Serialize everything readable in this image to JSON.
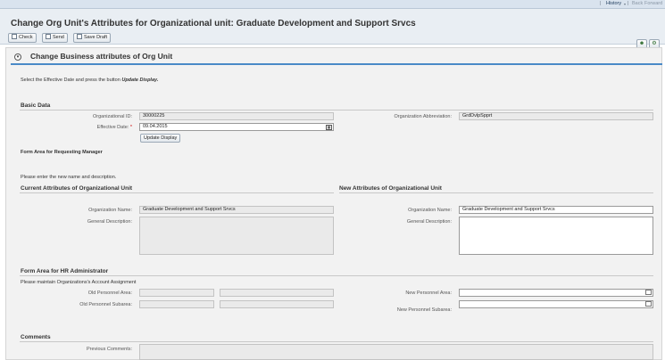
{
  "topnav": {
    "history": "History",
    "back": "Back",
    "forward": "Forward"
  },
  "header": {
    "title": "Change Org Unit's Attributes for Organizational unit: Graduate Development and Support Srvcs"
  },
  "toolbar": {
    "check": "Check",
    "send": "Send",
    "save_draft": "Save Draft"
  },
  "section": {
    "title": "Change Business attributes of Org Unit",
    "instruction_prefix": "Select the Effective Date and press the button ",
    "instruction_button": "Update Display."
  },
  "basic_data": {
    "heading": "Basic Data",
    "org_id_label": "Organizational ID:",
    "org_id_value": "30000225",
    "org_abbr_label": "Organization Abbreviation:",
    "org_abbr_value": "GrdDvlpSpprt",
    "effective_date_label": "Effective Date:",
    "required_mark": "*",
    "effective_date_value": "09.04.2015",
    "update_button": "Update Display"
  },
  "requesting_manager": {
    "heading": "Form Area for Requesting Manager",
    "instruction": "Please enter the new name and description."
  },
  "current": {
    "heading": "Current Attributes of Organizational Unit",
    "name_label": "Organization Name:",
    "name_value": "Graduate Development and Support Srvcs",
    "desc_label": "General Description:"
  },
  "new": {
    "heading": "New Attributes of Organizational Unit",
    "name_label": "Organization Name:",
    "name_value": "Graduate Development and Support Srvcs",
    "desc_label": "General Description:"
  },
  "hr_admin": {
    "heading": "Form Area for HR Administrator",
    "instruction": "Please maintain Organizations's Account Assignment",
    "old_area_label": "Old Personnel Area:",
    "old_subarea_label": "Old Personnel Subarea:",
    "new_area_label": "New Personnel Area:",
    "new_subarea_label": "New Personnel Subarea:"
  },
  "comments": {
    "heading": "Comments",
    "previous_label": "Previous Comments:"
  }
}
